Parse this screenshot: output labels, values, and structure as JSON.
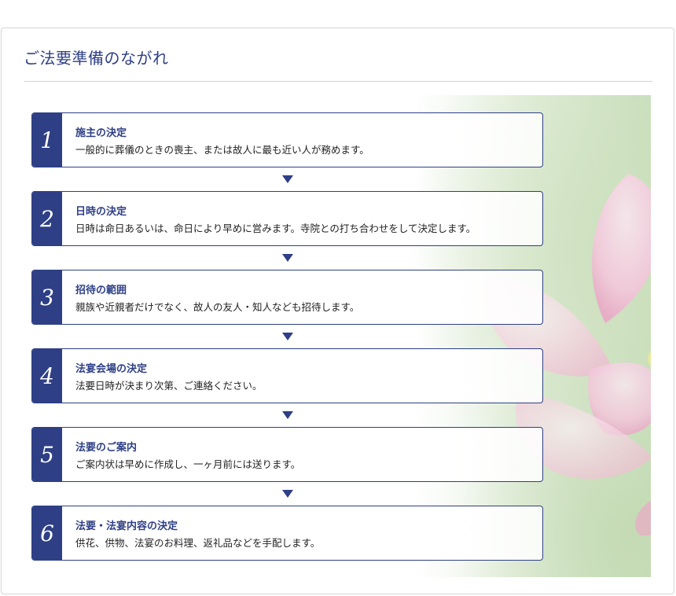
{
  "title": "ご法要準備のながれ",
  "colors": {
    "accent": "#2e3f86",
    "border": "#d6d6d6",
    "text": "#222222"
  },
  "steps": [
    {
      "number": "1",
      "title": "施主の決定",
      "description": "一般的に葬儀のときの喪主、または故人に最も近い人が務めます。"
    },
    {
      "number": "2",
      "title": "日時の決定",
      "description": "日時は命日あるいは、命日により早めに営みます。寺院との打ち合わせをして決定します。"
    },
    {
      "number": "3",
      "title": "招待の範囲",
      "description": "親族や近親者だけでなく、故人の友人・知人なども招待します。"
    },
    {
      "number": "4",
      "title": "法宴会場の決定",
      "description": "法要日時が決まり次第、ご連絡ください。"
    },
    {
      "number": "5",
      "title": "法要のご案内",
      "description": "ご案内状は早めに作成し、一ヶ月前には送ります。"
    },
    {
      "number": "6",
      "title": "法要・法宴内容の決定",
      "description": "供花、供物、法宴のお料理、返礼品などを手配します。"
    }
  ],
  "icons": {
    "flow_arrow": "triangle-down-icon",
    "background": "lotus-flower-image"
  }
}
